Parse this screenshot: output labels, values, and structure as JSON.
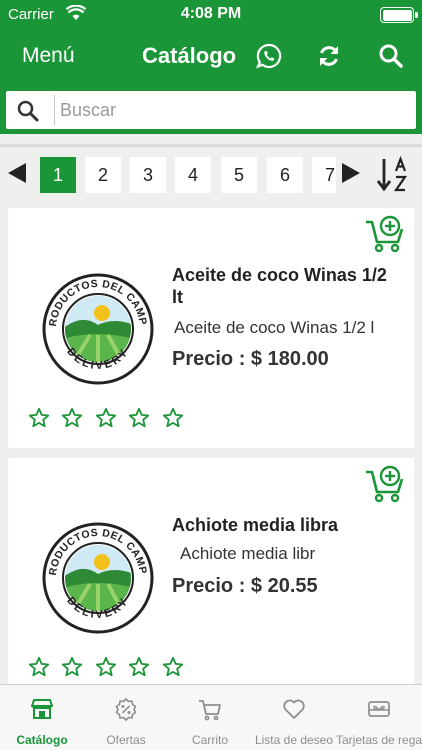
{
  "status_bar": {
    "carrier": "Carrier",
    "time": "4:08 PM"
  },
  "nav": {
    "menu_label": "Menú",
    "title": "Catálogo",
    "icons": [
      "whatsapp-icon",
      "refresh-icon",
      "search-icon"
    ]
  },
  "search": {
    "placeholder": "Buscar",
    "value": ""
  },
  "pager": {
    "pages": [
      "1",
      "2",
      "3",
      "4",
      "5",
      "6",
      "7"
    ],
    "current": "1"
  },
  "products": [
    {
      "name": "Aceite de coco Winas 1/2 lt",
      "description": "Aceite de coco Winas 1/2 l",
      "price": "Precio : $ 180.00",
      "logo_text": "PRODUCTOS DEL CAMPO DELIVERY",
      "rating": 0
    },
    {
      "name": "Achiote media libra",
      "description": "Achiote media libr",
      "price": "Precio : $ 20.55",
      "logo_text": "PRODUCTOS DEL CAMPO DELIVERY",
      "rating": 0
    }
  ],
  "tabs": [
    {
      "label": "Catálogo",
      "icon": "store-icon",
      "active": true
    },
    {
      "label": "Ofertas",
      "icon": "discount-icon",
      "active": false
    },
    {
      "label": "Carrito",
      "icon": "cart-icon",
      "active": false
    },
    {
      "label": "Lista de deseo",
      "icon": "heart-icon",
      "active": false
    },
    {
      "label": "Tarjetas de regalo",
      "icon": "gift-card-icon",
      "active": false
    }
  ],
  "colors": {
    "primary": "#1a9638",
    "star": "#1a9638"
  }
}
